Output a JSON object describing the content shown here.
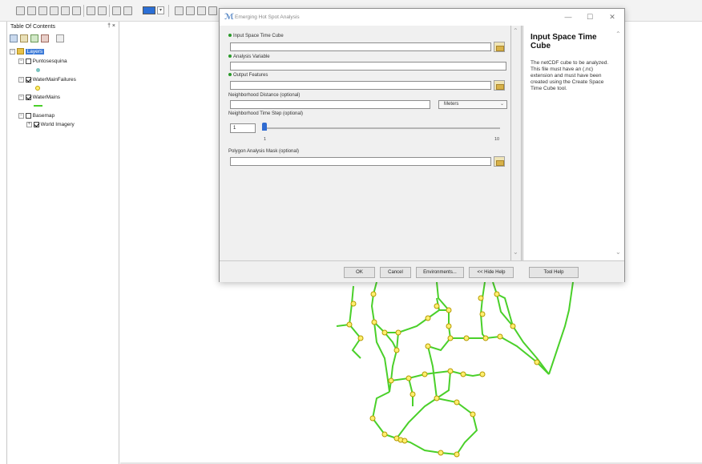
{
  "toc": {
    "title": "Table Of Contents",
    "controls": "† ×",
    "layers_label": "Layers",
    "items": [
      {
        "label": "Puntosesquina",
        "checked": false
      },
      {
        "label": "WaterMainFailures",
        "checked": true
      },
      {
        "label": "WaterMains",
        "checked": true
      },
      {
        "label": "Basemap",
        "checked": false
      },
      {
        "label": "World Imagery",
        "checked": true
      }
    ],
    "expander_minus": "−",
    "expander_plus": "+"
  },
  "dialog": {
    "title": "Emerging Hot Spot Analysis",
    "icon": "ℳ",
    "minimize": "—",
    "maximize": "☐",
    "close": "✕",
    "fields": {
      "input_cube_label": "Input Space Time Cube",
      "analysis_variable_label": "Analysis Variable",
      "output_features_label": "Output Features",
      "neighborhood_distance_label": "Neighborhood Distance (optional)",
      "distance_units": "Meters",
      "neighborhood_time_step_label": "Neighborhood Time Step (optional)",
      "time_step_value": "1",
      "slider_min": "1",
      "slider_max": "10",
      "slider_value_fraction": 0.0,
      "polygon_mask_label": "Polygon Analysis Mask (optional)"
    },
    "help": {
      "title": "Input Space Time Cube",
      "body": "The netCDF cube to be analyzed. This file must have an (.nc) extension and must have been created using the Create Space Time Cube tool."
    },
    "buttons": {
      "ok": "OK",
      "cancel": "Cancel",
      "environments": "Environments...",
      "hide_help": "<< Hide Help",
      "tool_help": "Tool Help"
    }
  },
  "colors": {
    "network_line": "#4ad02a",
    "node_fill": "#ffef70",
    "node_stroke": "#b59a00",
    "slider_thumb": "#2f6bd1",
    "layers_highlight": "#3d7bd8"
  },
  "icons": {
    "browse": "folder-open-icon",
    "required": "green-dot-icon",
    "dropdown": "chevron-down-icon"
  }
}
